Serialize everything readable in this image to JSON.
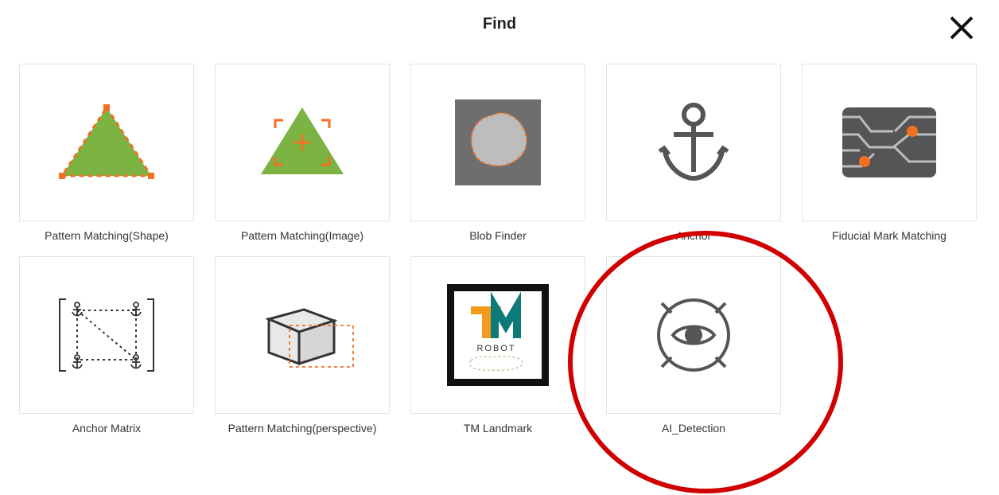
{
  "header": {
    "title": "Find"
  },
  "cards": [
    {
      "label": "Pattern Matching(Shape)",
      "icon": "pattern-shape-icon"
    },
    {
      "label": "Pattern Matching(Image)",
      "icon": "pattern-image-icon"
    },
    {
      "label": "Blob Finder",
      "icon": "blob-finder-icon"
    },
    {
      "label": "Anchor",
      "icon": "anchor-icon"
    },
    {
      "label": "Fiducial Mark Matching",
      "icon": "fiducial-mark-icon"
    },
    {
      "label": "Anchor Matrix",
      "icon": "anchor-matrix-icon"
    },
    {
      "label": "Pattern Matching(perspective)",
      "icon": "pattern-perspective-icon"
    },
    {
      "label": "TM Landmark",
      "icon": "tm-landmark-icon"
    },
    {
      "label": "AI_Detection",
      "icon": "ai-detection-icon"
    }
  ],
  "tm_landmark": {
    "line1": "TM",
    "line2": "ROBOT"
  },
  "highlight_index": 8,
  "colors": {
    "accent_green": "#7cb342",
    "accent_orange": "#f36f21",
    "grey_dark": "#555",
    "grey_mid": "#bdbdbd",
    "highlight": "#d00000"
  }
}
